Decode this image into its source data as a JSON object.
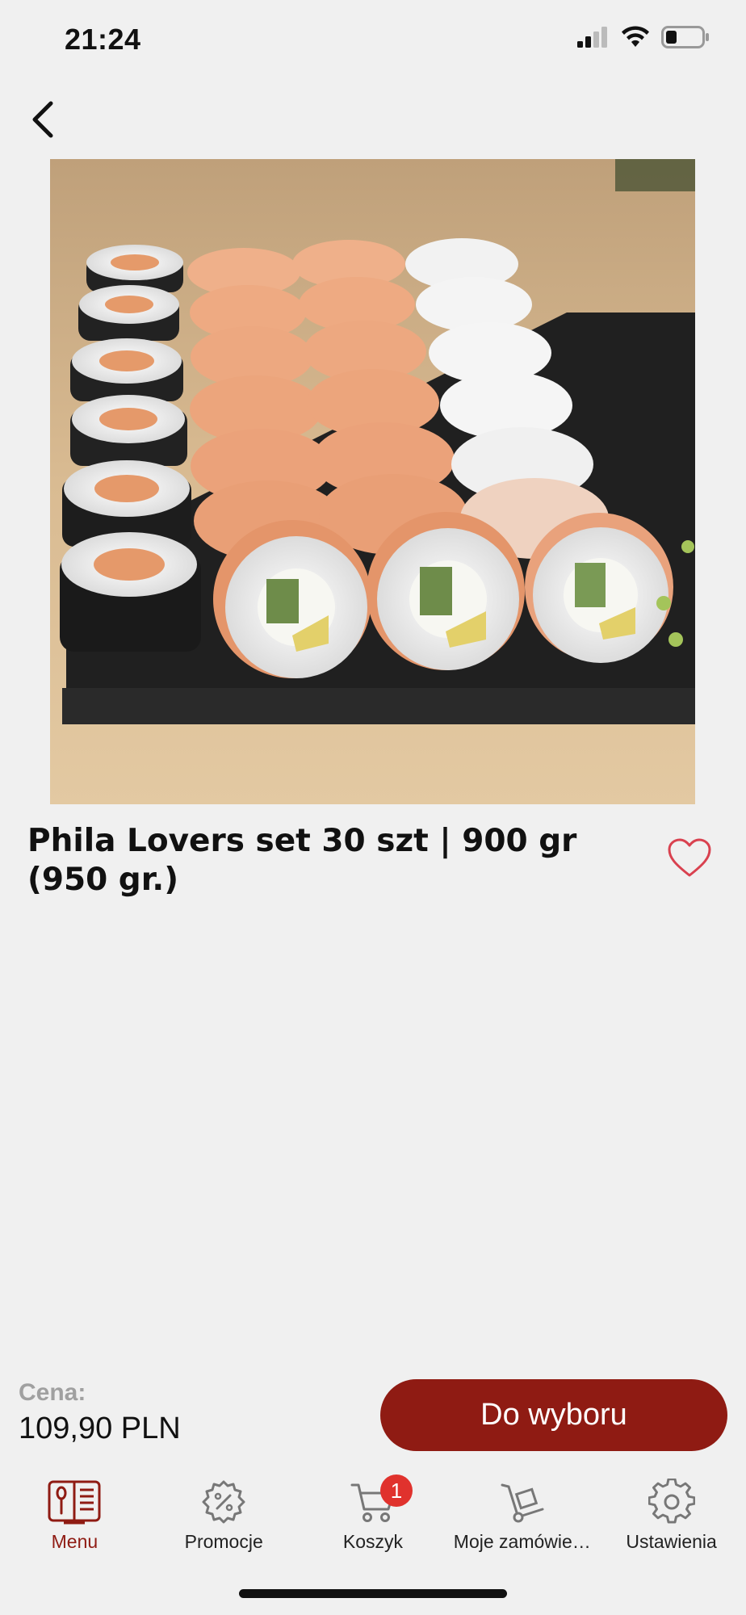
{
  "status_bar": {
    "time": "21:24"
  },
  "product": {
    "title": "Phila Lovers set 30 szt | 900 gr (950 gr.)",
    "image_icon": "sushi-photo"
  },
  "price": {
    "label": "Cena:",
    "value": "109,90 PLN"
  },
  "cta": {
    "label": "Do wyboru"
  },
  "tabs": [
    {
      "label": "Menu",
      "icon": "menu-book-icon",
      "active": true
    },
    {
      "label": "Promocje",
      "icon": "percent-badge-icon",
      "active": false
    },
    {
      "label": "Koszyk",
      "icon": "cart-icon",
      "active": false,
      "badge": "1"
    },
    {
      "label": "Moje zamówie…",
      "icon": "hand-truck-icon",
      "active": false
    },
    {
      "label": "Ustawienia",
      "icon": "gear-icon",
      "active": false
    }
  ],
  "colors": {
    "accent": "#8f1b13",
    "badge": "#e0322d",
    "heart": "#d9414f",
    "background": "#f0f0f0"
  }
}
